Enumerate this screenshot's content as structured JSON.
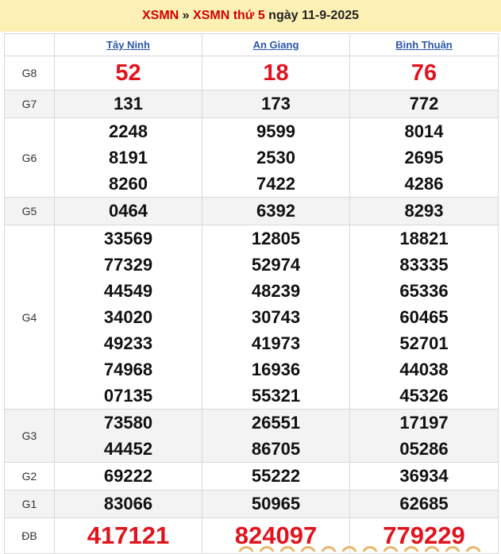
{
  "header": {
    "link1": "XSMN",
    "sep": " » ",
    "link2": "XSMN thứ 5",
    "date": " ngày 11-9-2025"
  },
  "provinces": [
    "Tây Ninh",
    "An Giang",
    "Bình Thuận"
  ],
  "prizes": [
    {
      "label": "G8",
      "values": [
        [
          "52"
        ],
        [
          "18"
        ],
        [
          "76"
        ]
      ]
    },
    {
      "label": "G7",
      "values": [
        [
          "131"
        ],
        [
          "173"
        ],
        [
          "772"
        ]
      ]
    },
    {
      "label": "G6",
      "values": [
        [
          "2248",
          "8191",
          "8260"
        ],
        [
          "9599",
          "2530",
          "7422"
        ],
        [
          "8014",
          "2695",
          "4286"
        ]
      ]
    },
    {
      "label": "G5",
      "values": [
        [
          "0464"
        ],
        [
          "6392"
        ],
        [
          "8293"
        ]
      ]
    },
    {
      "label": "G4",
      "values": [
        [
          "33569",
          "77329",
          "44549",
          "34020",
          "49233",
          "74968",
          "07135"
        ],
        [
          "12805",
          "52974",
          "48239",
          "30743",
          "41973",
          "16936",
          "55321"
        ],
        [
          "18821",
          "83335",
          "65336",
          "60465",
          "52701",
          "44038",
          "45326"
        ]
      ]
    },
    {
      "label": "G3",
      "values": [
        [
          "73580",
          "44452"
        ],
        [
          "26551",
          "86705"
        ],
        [
          "17197",
          "05286"
        ]
      ]
    },
    {
      "label": "G2",
      "values": [
        [
          "69222"
        ],
        [
          "55222"
        ],
        [
          "36934"
        ]
      ]
    },
    {
      "label": "G1",
      "values": [
        [
          "83066"
        ],
        [
          "50965"
        ],
        [
          "62685"
        ]
      ]
    },
    {
      "label": "ĐB",
      "values": [
        [
          "417121"
        ],
        [
          "824097"
        ],
        [
          "779229"
        ]
      ]
    }
  ],
  "colors": {
    "accent": "#e0141e",
    "header_bg": "#fdf0b4",
    "link": "#2a57a8"
  }
}
